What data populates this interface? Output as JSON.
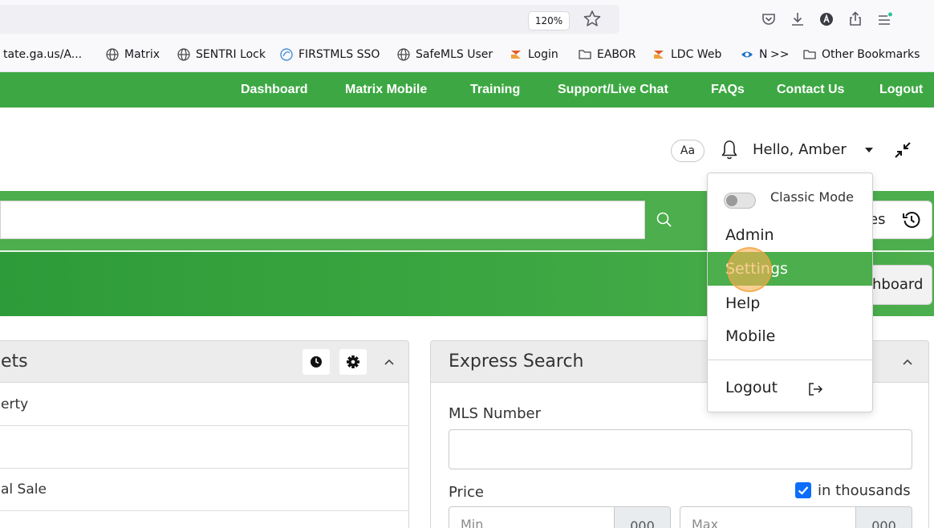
{
  "browser": {
    "zoom_level": "120%",
    "bookmarks": [
      {
        "label": "tate.ga.us/A...",
        "icon": "none"
      },
      {
        "label": "Matrix",
        "icon": "globe-icon"
      },
      {
        "label": "SENTRI Lock",
        "icon": "globe-icon"
      },
      {
        "label": "FIRSTMLS SSO",
        "icon": "firstmls-icon"
      },
      {
        "label": "SafeMLS User",
        "icon": "globe-icon"
      },
      {
        "label": "Login",
        "icon": "login-logo-icon"
      },
      {
        "label": "EABOR",
        "icon": "folder-icon"
      },
      {
        "label": "LDC Web",
        "icon": "ldc-logo-icon"
      },
      {
        "label": "N",
        "icon": "n-logo-icon"
      },
      {
        "label": ">>",
        "icon": "none"
      },
      {
        "label": "Other Bookmarks",
        "icon": "folder-icon"
      }
    ]
  },
  "site_nav": {
    "links": [
      "Dashboard",
      "Matrix Mobile",
      "Training",
      "Support/Live Chat",
      "FAQs",
      "Contact Us",
      "Logout"
    ],
    "color": "#3da843"
  },
  "header": {
    "font_size_button": "Aa",
    "greeting": "Hello, Amber"
  },
  "search": {
    "history_partial_label": "es"
  },
  "banner": {
    "dashboard_partial_label": "hboard"
  },
  "left_panel": {
    "title_partial": "ets",
    "rows": [
      "erty",
      "",
      "al Sale"
    ]
  },
  "express_search": {
    "title": "Express Search",
    "mls_label": "MLS Number",
    "price_label": "Price",
    "in_thousands_label": "in thousands",
    "in_thousands_checked": true,
    "min_placeholder": "Min",
    "max_placeholder": "Max",
    "suffix": "000"
  },
  "user_menu": {
    "classic_mode_label": "Classic Mode",
    "classic_mode_on": false,
    "items": [
      "Admin",
      "Settings",
      "Help",
      "Mobile"
    ],
    "active_item": "Settings",
    "logout_label": "Logout",
    "accent": "#4cae4c"
  }
}
